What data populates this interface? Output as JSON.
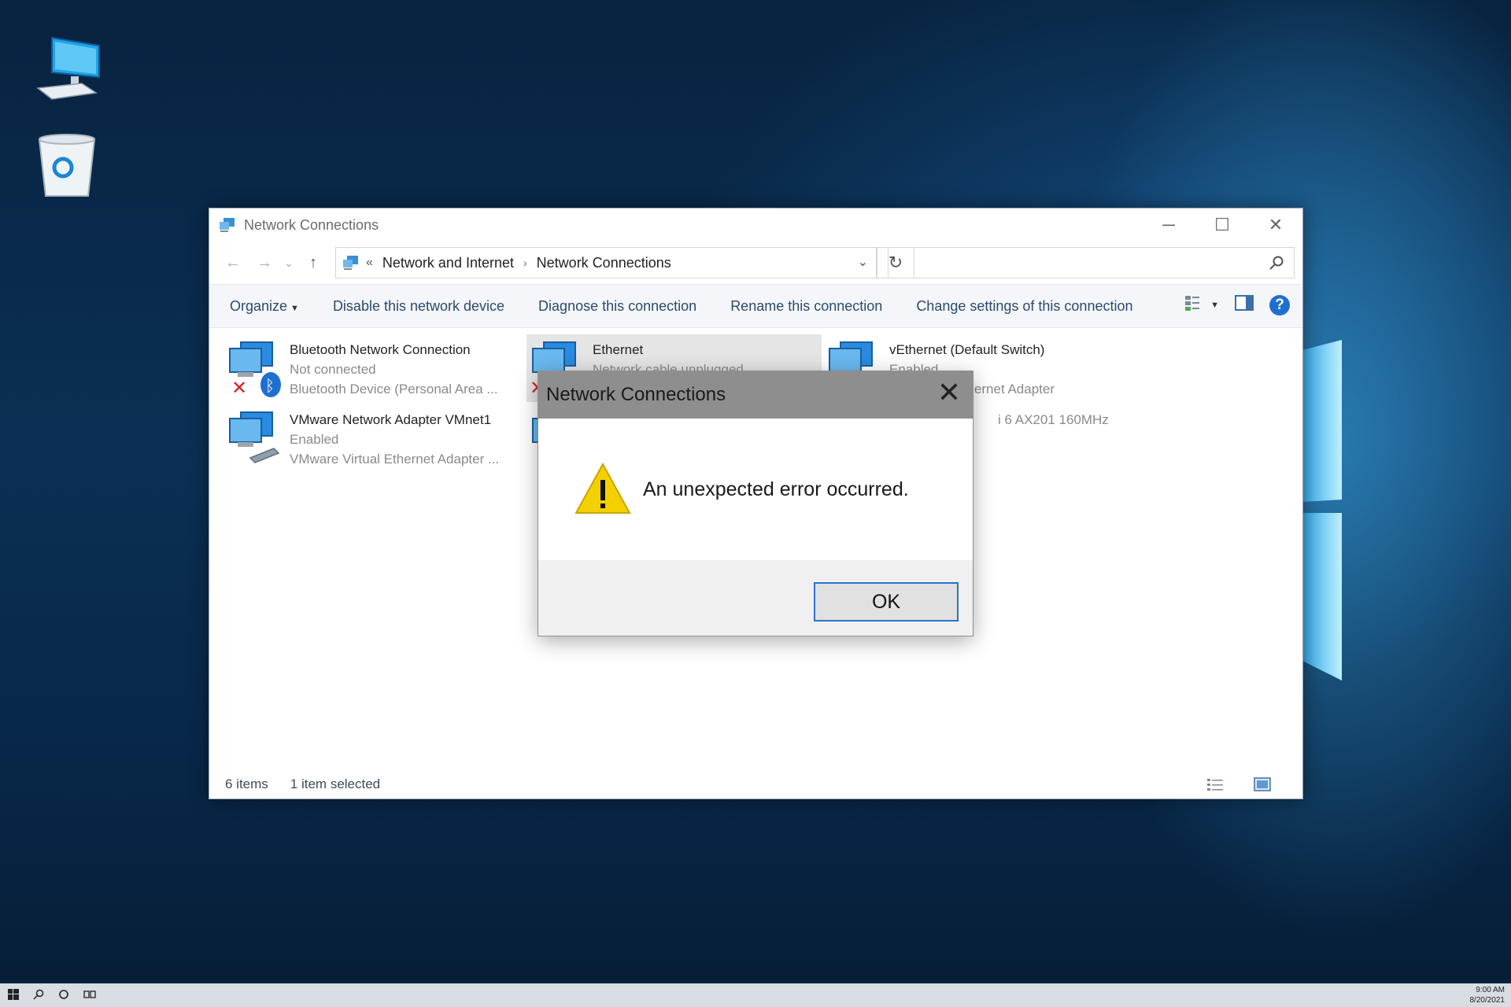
{
  "window": {
    "title": "Network Connections",
    "controls": {
      "minimize": "─",
      "maximize": "☐",
      "close": "✕"
    }
  },
  "navigation": {
    "back": "←",
    "forward": "→",
    "recent": "⌄",
    "up": "↑",
    "address_prefix": "«",
    "breadcrumbs": [
      "Network and Internet",
      "Network Connections"
    ],
    "separator": "›",
    "dropdown": "⌄",
    "refresh": "↻",
    "search_placeholder": ""
  },
  "toolbar": {
    "organize": "Organize",
    "organize_caret": "▼",
    "disable": "Disable this network device",
    "diagnose": "Diagnose this connection",
    "rename": "Rename this connection",
    "change_settings": "Change settings of this connection",
    "view_caret": "▼",
    "help": "?"
  },
  "connections": [
    {
      "name": "Bluetooth Network Connection",
      "status": "Not connected",
      "device": "Bluetooth Device (Personal Area ...",
      "icon": "network-adapter-icon",
      "overlay": "bluetooth-disconnected"
    },
    {
      "name": "Ethernet",
      "status": "Network cable unplugged",
      "device": "",
      "icon": "network-adapter-icon",
      "overlay": "disconnected",
      "selected": true
    },
    {
      "name": "vEthernet (Default Switch)",
      "status": "Enabled",
      "device": "ual Ethernet Adapter",
      "icon": "network-adapter-icon",
      "overlay": "none"
    },
    {
      "name": "VMware Network Adapter VMnet1",
      "status": "Enabled",
      "device": "VMware Virtual Ethernet Adapter ...",
      "icon": "network-adapter-icon",
      "overlay": "cable"
    },
    {
      "name": "",
      "status": "",
      "device": "i 6 AX201 160MHz",
      "icon": "network-adapter-icon",
      "overlay": "none"
    }
  ],
  "statusbar": {
    "count": "6 items",
    "selection": "1 item selected"
  },
  "dialog": {
    "title": "Network Connections",
    "close": "✕",
    "message": "An unexpected error occurred.",
    "ok": "OK",
    "icon": "warning-icon"
  },
  "taskbar": {
    "clock_time": "9:00 AM",
    "clock_date": "8/20/2021"
  },
  "colors": {
    "accent": "#2a73cc",
    "link_text": "#2b4a6e",
    "dialog_title_bg": "#8e8e8e",
    "warning": "#f5d000",
    "error_x": "#e02020"
  }
}
